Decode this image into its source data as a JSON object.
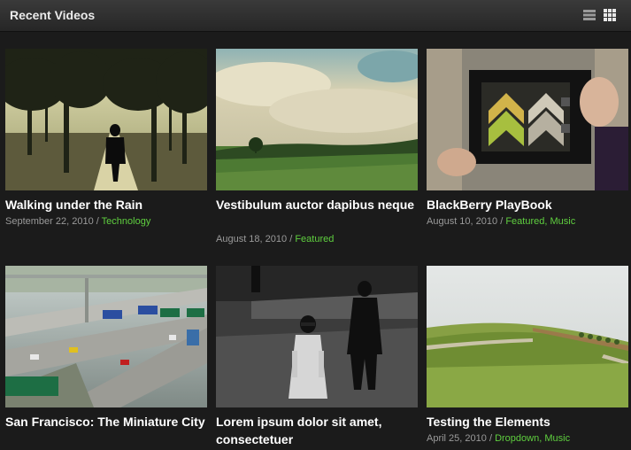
{
  "header": {
    "title": "Recent Videos",
    "view_list_icon": "list-view-icon",
    "view_grid_icon": "grid-view-icon"
  },
  "colors": {
    "category_link": "#5fcf3f",
    "date_text": "#9a9a9a",
    "background": "#1b1b1b"
  },
  "videos": [
    {
      "title": "Walking under the Rain",
      "date": "September 22, 2010",
      "categories": [
        "Technology"
      ]
    },
    {
      "title": "Vestibulum auctor dapibus neque",
      "date": "August 18, 2010",
      "categories": [
        "Featured"
      ]
    },
    {
      "title": "BlackBerry PlayBook",
      "date": "August 10, 2010",
      "categories": [
        "Featured",
        "Music"
      ]
    },
    {
      "title": "San Francisco: The Miniature City",
      "date": "",
      "categories": []
    },
    {
      "title": "Lorem ipsum dolor sit amet, consectetuer",
      "date": "",
      "categories": []
    },
    {
      "title": "Testing the Elements",
      "date": "April 25, 2010",
      "categories": [
        "Dropdown",
        "Music"
      ]
    }
  ]
}
